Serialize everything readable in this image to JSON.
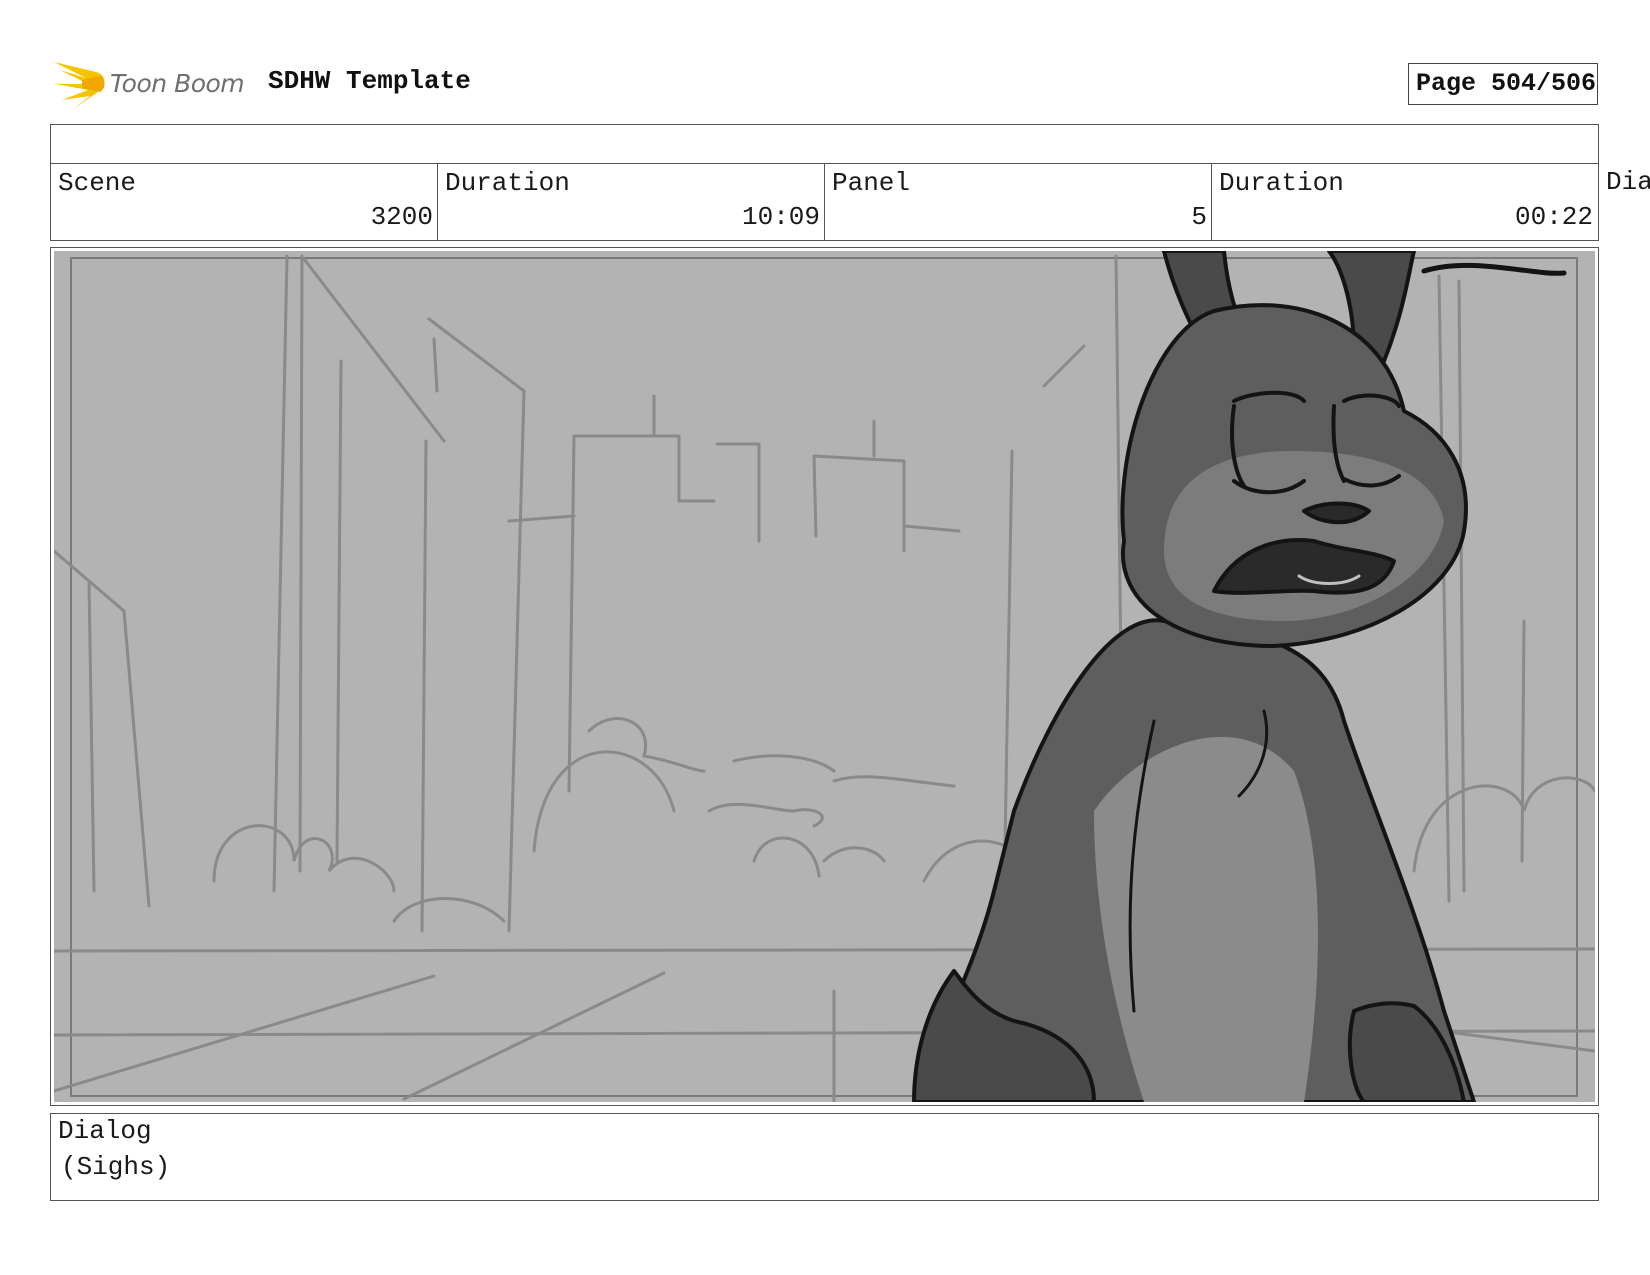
{
  "header": {
    "logo_text": "Toon Boom",
    "title": "SDHW Template",
    "page_label": "Page 504/506"
  },
  "info": {
    "scene_label": "Scene",
    "scene_value": "3200",
    "scene_duration_label": "Duration",
    "scene_duration_value": "10:09",
    "panel_label": "Panel",
    "panel_value": "5",
    "panel_duration_label": "Duration",
    "panel_duration_value": "00:22",
    "overflow_label": "Dia"
  },
  "dialog": {
    "label": "Dialog",
    "text": "(Sighs)"
  },
  "colors": {
    "logo_flame": "#f5c400",
    "sketch_background": "#b3b3b3",
    "character_fill": "#5b5b5b"
  },
  "icons": {
    "logo": "toon-boom-flame-icon"
  }
}
